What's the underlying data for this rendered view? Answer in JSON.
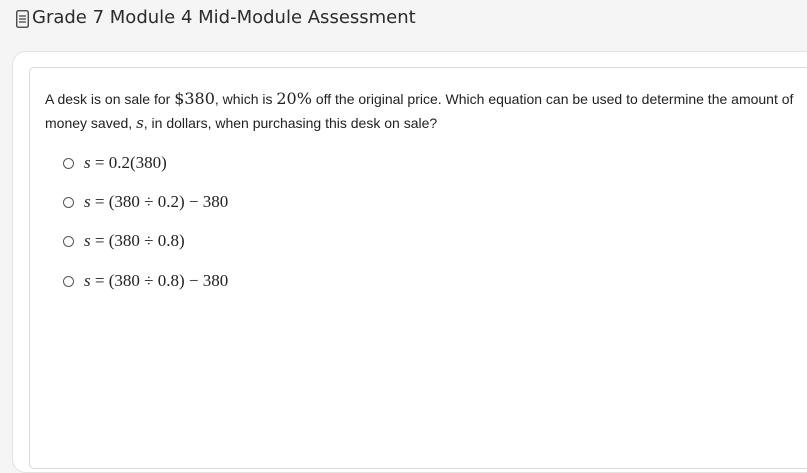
{
  "header": {
    "title": "Grade 7 Module 4 Mid-Module Assessment",
    "icon": "document-icon"
  },
  "question": {
    "part1": "A desk is on sale for ",
    "price": "$380",
    "part2": ", which is ",
    "percent": "20%",
    "part3": " off the original price.  Which equation can be used to determine the amount of money saved, ",
    "variable": "s",
    "part4": ", in dollars, when purchasing this desk on sale?"
  },
  "choices": [
    {
      "var": "s",
      "expr": " = 0.2(380)"
    },
    {
      "var": "s",
      "expr": " = (380 ÷ 0.2) − 380"
    },
    {
      "var": "s",
      "expr": " = (380 ÷ 0.8)"
    },
    {
      "var": "s",
      "expr": " = (380 ÷ 0.8) − 380"
    }
  ]
}
